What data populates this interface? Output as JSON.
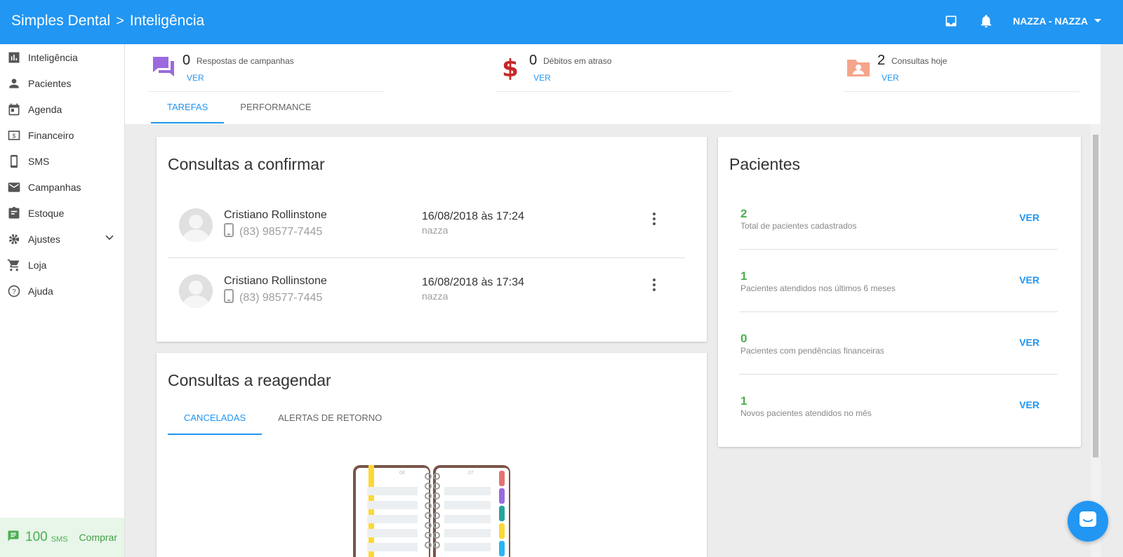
{
  "header": {
    "brand": "Simples Dental",
    "separator": ">",
    "section": "Inteligência",
    "user_label": "NAZZA - NAZZA",
    "icons": [
      "inbox-icon",
      "bell-icon",
      "caret-down-icon"
    ]
  },
  "sidebar": {
    "items": [
      {
        "label": "Inteligência",
        "icon": "bar-chart-icon"
      },
      {
        "label": "Pacientes",
        "icon": "person-icon"
      },
      {
        "label": "Agenda",
        "icon": "calendar-icon"
      },
      {
        "label": "Financeiro",
        "icon": "money-icon"
      },
      {
        "label": "SMS",
        "icon": "phone-icon"
      },
      {
        "label": "Campanhas",
        "icon": "mail-icon"
      },
      {
        "label": "Estoque",
        "icon": "clipboard-icon"
      },
      {
        "label": "Ajustes",
        "icon": "gear-icon"
      },
      {
        "label": "Loja",
        "icon": "cart-icon"
      },
      {
        "label": "Ajuda",
        "icon": "help-icon"
      }
    ],
    "sms": {
      "count": "100",
      "unit": "SMS",
      "buy": "Comprar"
    }
  },
  "summary": [
    {
      "value": "0",
      "label": "Respostas de campanhas",
      "link": "VER",
      "icon": "chat-bubbles-icon",
      "color": "#9c6ade"
    },
    {
      "value": "0",
      "label": "Débitos em atraso",
      "link": "VER",
      "icon": "dollar-icon",
      "color": "#c62828"
    },
    {
      "value": "2",
      "label": "Consultas hoje",
      "link": "VER",
      "icon": "patient-folder-icon",
      "color": "#f4a58a"
    }
  ],
  "tabs": [
    {
      "label": "TAREFAS"
    },
    {
      "label": "PERFORMANCE"
    }
  ],
  "confirm": {
    "title": "Consultas a confirmar",
    "appointments": [
      {
        "name": "Cristiano Rollinstone",
        "phone": "(83) 98577-7445",
        "date": "16/08/2018 às 17:24",
        "user": "nazza"
      },
      {
        "name": "Cristiano Rollinstone",
        "phone": "(83) 98577-7445",
        "date": "16/08/2018 às 17:34",
        "user": "nazza"
      }
    ]
  },
  "reschedule": {
    "title": "Consultas a reagendar",
    "tabs": [
      {
        "label": "CANCELADAS"
      },
      {
        "label": "ALERTAS DE RETORNO"
      }
    ],
    "page_left": "06",
    "page_right": "07"
  },
  "patients": {
    "title": "Pacientes",
    "rows": [
      {
        "value": "2",
        "label": "Total de pacientes cadastrados",
        "link": "VER"
      },
      {
        "value": "1",
        "label": "Pacientes atendidos nos últimos 6 meses",
        "link": "VER"
      },
      {
        "value": "0",
        "label": "Pacientes com pendências financeiras",
        "link": "VER"
      },
      {
        "value": "1",
        "label": "Novos pacientes atendidos no mês",
        "link": "VER"
      }
    ]
  },
  "colors": {
    "primary": "#2196f3",
    "success": "#4caf50",
    "background": "#ececec"
  }
}
